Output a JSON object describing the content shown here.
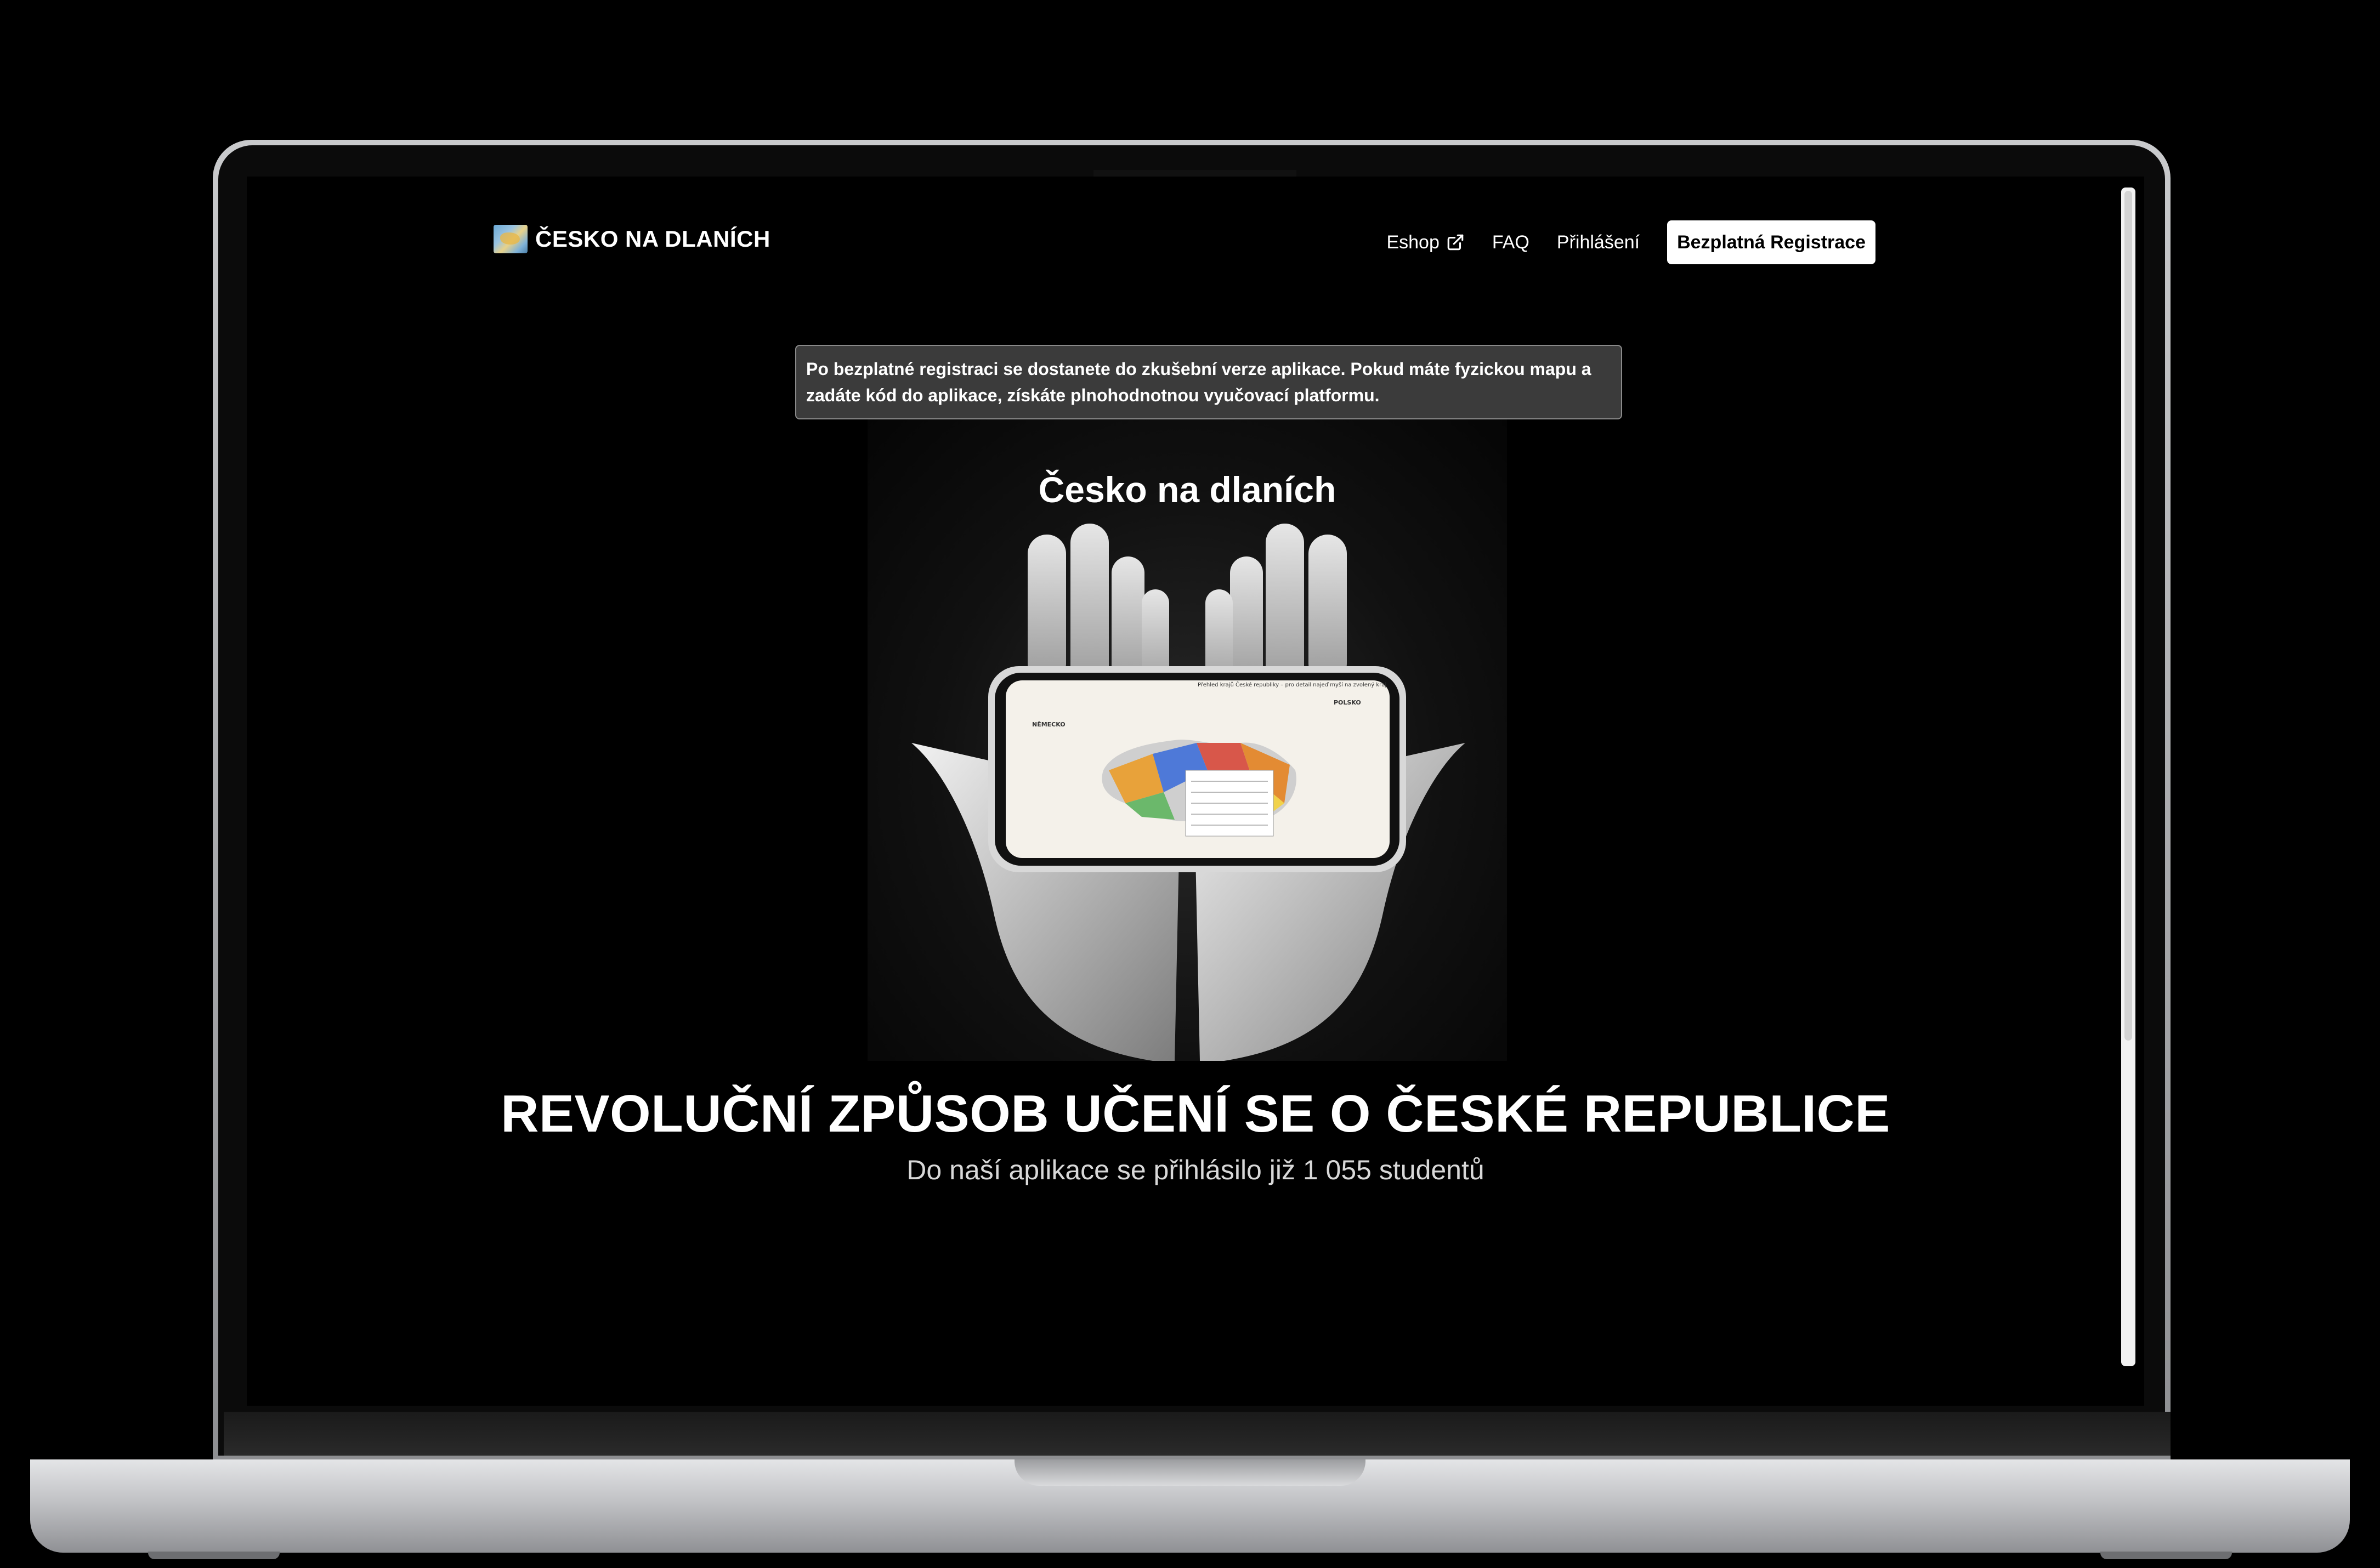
{
  "navbar": {
    "brand": "ČESKO NA DLANÍCH",
    "links": {
      "eshop": "Eshop",
      "faq": "FAQ",
      "login": "Přihlášení"
    },
    "cta": "Bezplatná Registrace"
  },
  "notice": "Po bezplatné registraci se dostanete do zkušební verze aplikace. Pokud máte fyzickou mapu a zadáte kód do aplikace, získáte plnohodnotnou vyučovací platformu.",
  "hero": {
    "image_caption": "Česko na dlaních",
    "title": "REVOLUČNÍ ZPŮSOB UČENÍ SE O ČESKÉ REPUBLICE",
    "subtitle": "Do naší aplikace se přihlásilo již 1 055 studentů",
    "phone_map_labels": {
      "header": "Přehled krajů České republiky – pro detail najeď myší na zvolený kraj",
      "germany": "NĚMECKO",
      "poland": "POLSKO"
    }
  },
  "colors": {
    "background": "#000000",
    "notice_bg": "#3b3b3b",
    "cta_bg": "#ffffff"
  },
  "icons": {
    "external": "external-link-icon",
    "brand": "czech-map-logo-icon"
  }
}
